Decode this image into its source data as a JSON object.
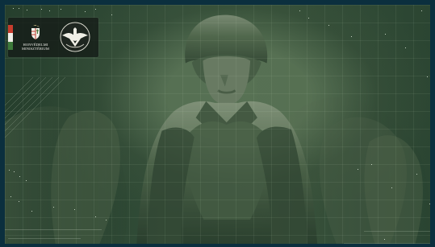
{
  "brand": {
    "ministry_line_1": "HONVÉDELMI",
    "ministry_line_2": "MINISZTÉRIUM",
    "flag_colors": [
      "#c83d2d",
      "#f0eee7",
      "#3d7a3a"
    ]
  },
  "visual": {
    "background": "#0b2f3e",
    "tint": "#355039",
    "grid": "rgba(220,240,210,.07)",
    "logos": [
      "hungarian-coat-of-arms-icon",
      "eagle-badge-icon"
    ]
  }
}
